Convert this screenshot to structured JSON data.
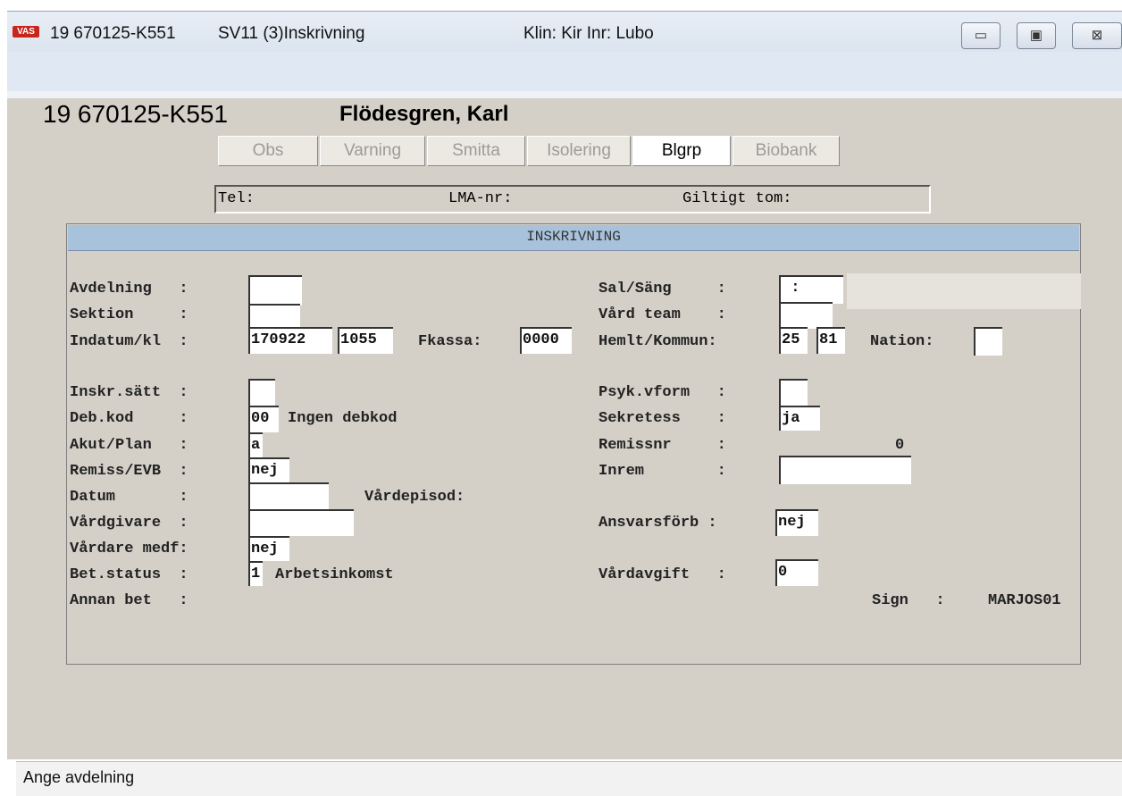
{
  "window": {
    "logo": "VAS",
    "patient_id": "19 670125-K551",
    "screen": "SV11 (3)Inskrivning",
    "context": "Klin: Kir  Inr: Lubo",
    "minimize": "▭",
    "maximize": "▣",
    "close": "⊠"
  },
  "header": {
    "patient_id": "19 670125-K551",
    "patient_name": "Flödesgren, Karl",
    "tabs": [
      "Obs",
      "Varning",
      "Smitta",
      "Isolering",
      "Blgrp",
      "Biobank"
    ],
    "active_tab": "Blgrp"
  },
  "info_line": {
    "tel": "Tel:",
    "lma": "LMA-nr:",
    "valid": "Giltigt tom:"
  },
  "form": {
    "title": "INSKRIVNING",
    "left": {
      "avdelning": {
        "label": "Avdelning   :",
        "value": ""
      },
      "sektion": {
        "label": "Sektion     :",
        "value": ""
      },
      "indatum": {
        "label": "Indatum/kl  :",
        "date": "170922",
        "time": "1055"
      },
      "fkassa": {
        "label": "Fkassa:",
        "value": "0000"
      },
      "inskr_satt": {
        "label": "Inskr.sätt  :",
        "value": ""
      },
      "deb_kod": {
        "label": "Deb.kod     :",
        "value": "00",
        "text": "Ingen debkod"
      },
      "akut_plan": {
        "label": "Akut/Plan   :",
        "value": "a"
      },
      "remiss_evb": {
        "label": "Remiss/EVB  :",
        "value": "nej"
      },
      "datum": {
        "label": "Datum       :",
        "value": ""
      },
      "vardepisod": {
        "label": "Vårdepisod:"
      },
      "vardgivare": {
        "label": "Vårdgivare  :",
        "value": ""
      },
      "vardare_medf": {
        "label": "Vårdare medf:",
        "value": "nej"
      },
      "bet_status": {
        "label": "Bet.status  :",
        "value": "1",
        "text": "Arbetsinkomst"
      },
      "annan_bet": {
        "label": "Annan bet   :"
      }
    },
    "right": {
      "sal_sang": {
        "label": "Sal/Säng     :",
        "value": " :"
      },
      "vard_team": {
        "label": "Vård team    :",
        "value": ""
      },
      "hemlt": {
        "label": "Hemlt/Kommun:",
        "v1": "25",
        "v2": "81"
      },
      "nation": {
        "label": "Nation:",
        "value": ""
      },
      "psyk": {
        "label": "Psyk.vform   :",
        "value": ""
      },
      "sekretess": {
        "label": "Sekretess    :",
        "value": "ja"
      },
      "remissnr": {
        "label": "Remissnr     :",
        "value": "0"
      },
      "inrem": {
        "label": "Inrem        :",
        "value": ""
      },
      "ansvarsforb": {
        "label": "Ansvarsförb :",
        "value": "nej"
      },
      "vardavgift": {
        "label": "Vårdavgift   :",
        "value": "0"
      },
      "sign": {
        "label": "Sign   :",
        "value": "MARJOS01"
      }
    }
  },
  "status_bar": {
    "text": "Ange avdelning"
  }
}
